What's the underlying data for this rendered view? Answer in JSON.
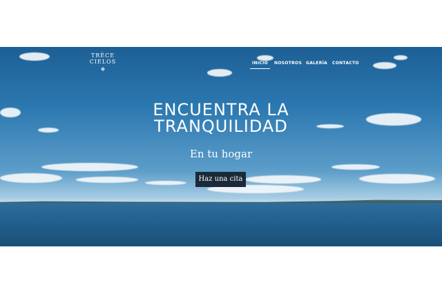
{
  "brand": {
    "name_line1": "TRÉCE",
    "name_line2": "CIELOS",
    "emblem": "❖"
  },
  "nav": {
    "items": [
      {
        "label": "INICIO",
        "active": true
      },
      {
        "label": "NOSOTROS",
        "active": false
      },
      {
        "label": "GALERÍA",
        "active": false
      },
      {
        "label": "CONTACTO",
        "active": false
      }
    ]
  },
  "hero": {
    "headline_line1": "ENCUENTRA LA",
    "headline_line2": "TRANQUILIDAD",
    "subtitle": "En tu hogar",
    "cta_label": "Haz una cita"
  },
  "colors": {
    "sky_top": "#1d5f94",
    "sea": "#23618f",
    "cta_background": "#1a2a3a",
    "text": "#ffffff"
  }
}
